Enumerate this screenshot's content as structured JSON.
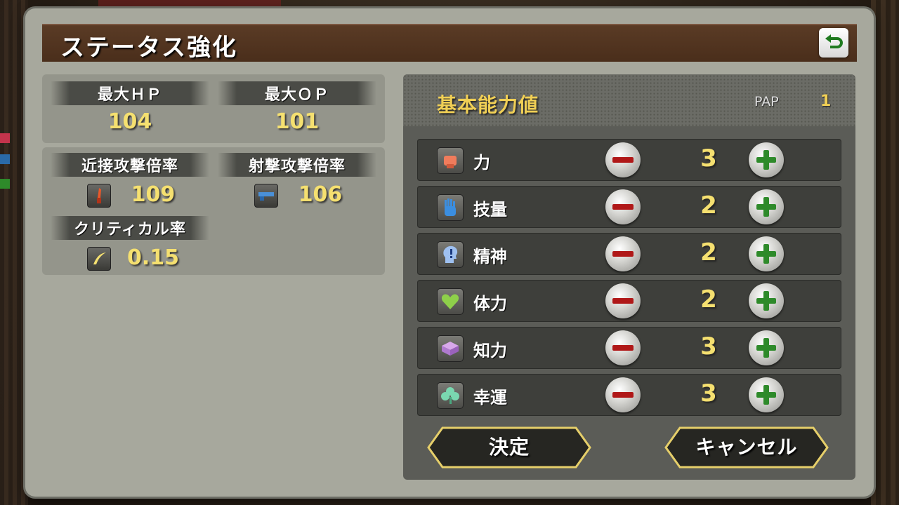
{
  "dialog": {
    "title": "ステータス強化"
  },
  "left": {
    "max_hp": {
      "label": "最大ＨＰ",
      "value": "104"
    },
    "max_op": {
      "label": "最大ＯＰ",
      "value": "101"
    },
    "melee": {
      "label": "近接攻撃倍率",
      "value": "109",
      "icon": "knife-icon"
    },
    "ranged": {
      "label": "射撃攻撃倍率",
      "value": "106",
      "icon": "gun-icon"
    },
    "critical": {
      "label": "クリティカル率",
      "value": "0.15",
      "icon": "critical-icon"
    }
  },
  "right": {
    "title": "基本能力値",
    "pap_label": "PAP",
    "pap_value": "1",
    "attributes": [
      {
        "name": "力",
        "value": "3",
        "icon": "fist-icon"
      },
      {
        "name": "技量",
        "value": "2",
        "icon": "hand-icon"
      },
      {
        "name": "精神",
        "value": "2",
        "icon": "mind-icon"
      },
      {
        "name": "体力",
        "value": "2",
        "icon": "heart-icon"
      },
      {
        "name": "知力",
        "value": "3",
        "icon": "book-icon"
      },
      {
        "name": "幸運",
        "value": "3",
        "icon": "clover-icon"
      }
    ]
  },
  "buttons": {
    "confirm": "決定",
    "cancel": "キャンセル"
  },
  "colors": {
    "value_yellow": "#f5e070",
    "title_brown": "#4a2e1b",
    "minus_red": "#b01818",
    "plus_green": "#2e8a2a"
  }
}
